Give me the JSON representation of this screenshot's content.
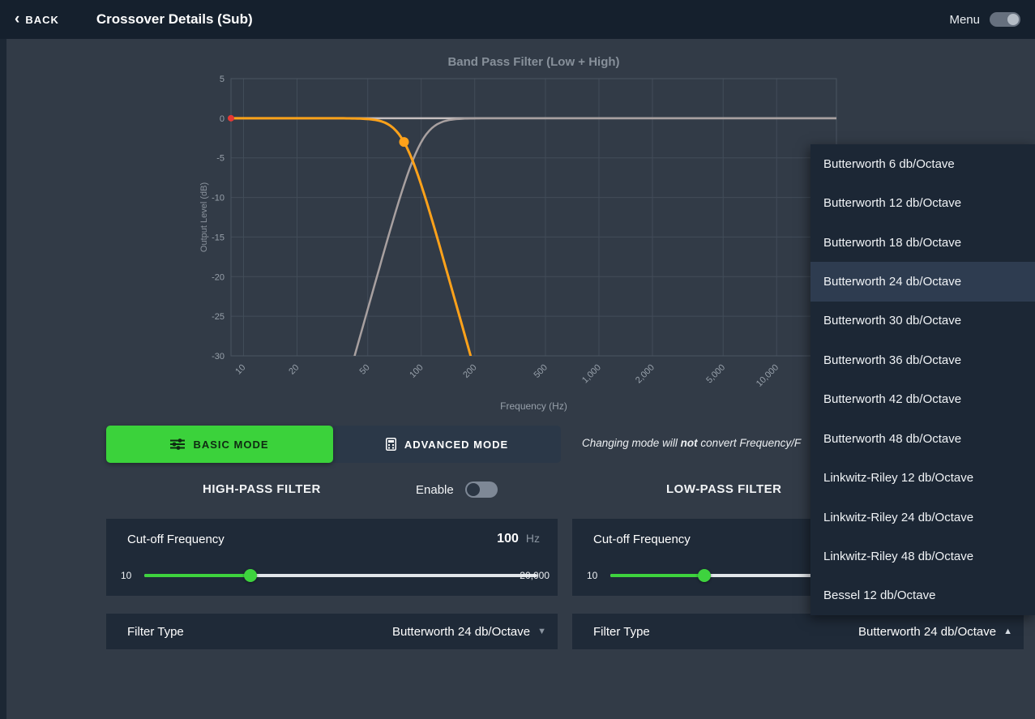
{
  "header": {
    "back_label": "BACK",
    "title": "Crossover Details (Sub)",
    "menu_label": "Menu"
  },
  "chart_data": {
    "type": "line",
    "title": "Band Pass Filter (Low + High)",
    "xlabel": "Frequency (Hz)",
    "ylabel": "Output Level (dB)",
    "x_scale": "log",
    "xlim": [
      8.5,
      21700
    ],
    "ylim": [
      -30,
      5
    ],
    "x_ticks": [
      10,
      20,
      50,
      100,
      200,
      500,
      1000,
      2000,
      5000,
      10000
    ],
    "x_tick_labels": [
      "10",
      "20",
      "50",
      "100",
      "200",
      "500",
      "1,000",
      "2,000",
      "5,000",
      "10,000"
    ],
    "y_ticks": [
      5,
      0,
      -5,
      -10,
      -15,
      -20,
      -25,
      -30
    ],
    "grid": true,
    "series": [
      {
        "name": "combined-output",
        "type": "flat",
        "level_db": 0,
        "color": "#c6bfbf",
        "width": 2.5
      },
      {
        "name": "high-pass-preview",
        "type": "butterworth_highpass",
        "cutoff_hz": 100,
        "slope_db_per_octave": 24,
        "color": "#a8a0a0",
        "width": 2.5
      },
      {
        "name": "low-pass-preview",
        "type": "butterworth_lowpass",
        "cutoff_hz": 80,
        "slope_db_per_octave": 24,
        "color": "#ffa21a",
        "width": 3
      }
    ],
    "markers": [
      {
        "name": "lpf-cutoff-handle",
        "x": 80,
        "y": -3,
        "color": "#ffa21a",
        "r": 6
      },
      {
        "name": "hpf-edge-marker",
        "x": 8.5,
        "y": 0,
        "color": "#e53935",
        "r": 4
      }
    ]
  },
  "modes": {
    "basic_label": "BASIC MODE",
    "advanced_label": "ADVANCED MODE",
    "active": "basic",
    "note_prefix": "Changing mode will ",
    "note_bold": "not",
    "note_suffix": " convert Frequency/F"
  },
  "hpf": {
    "section_label": "HIGH-PASS FILTER",
    "enable_label": "Enable",
    "enabled": false,
    "cutoff": {
      "label": "Cut-off Frequency",
      "value": "100",
      "unit": "Hz",
      "min_label": "10",
      "max_label": "20,000",
      "percent": 27
    },
    "filter_type": {
      "label": "Filter Type",
      "value": "Butterworth 24 db/Octave"
    }
  },
  "lpf": {
    "section_label": "LOW-PASS FILTER",
    "cutoff": {
      "label": "Cut-off Frequency",
      "min_label": "10",
      "percent": 24
    },
    "filter_type": {
      "label": "Filter Type",
      "value": "Butterworth 24 db/Octave"
    }
  },
  "dropdown": {
    "selected_index": 3,
    "options": [
      "Butterworth 6 db/Octave",
      "Butterworth 12 db/Octave",
      "Butterworth 18 db/Octave",
      "Butterworth 24 db/Octave",
      "Butterworth 30 db/Octave",
      "Butterworth 36 db/Octave",
      "Butterworth 42 db/Octave",
      "Butterworth 48 db/Octave",
      "Linkwitz-Riley 12 db/Octave",
      "Linkwitz-Riley 24 db/Octave",
      "Linkwitz-Riley 48 db/Octave",
      "Bessel 12 db/Octave"
    ]
  },
  "colors": {
    "accent_green": "#3ed33e",
    "curve_orange": "#ffa21a",
    "curve_gray": "#a8a0a0",
    "marker_red": "#e53935",
    "panel_bg": "#1f2a38",
    "header_bg": "#15202d",
    "dropdown_bg": "#1c2735",
    "dropdown_selected_bg": "#2e3c50"
  }
}
